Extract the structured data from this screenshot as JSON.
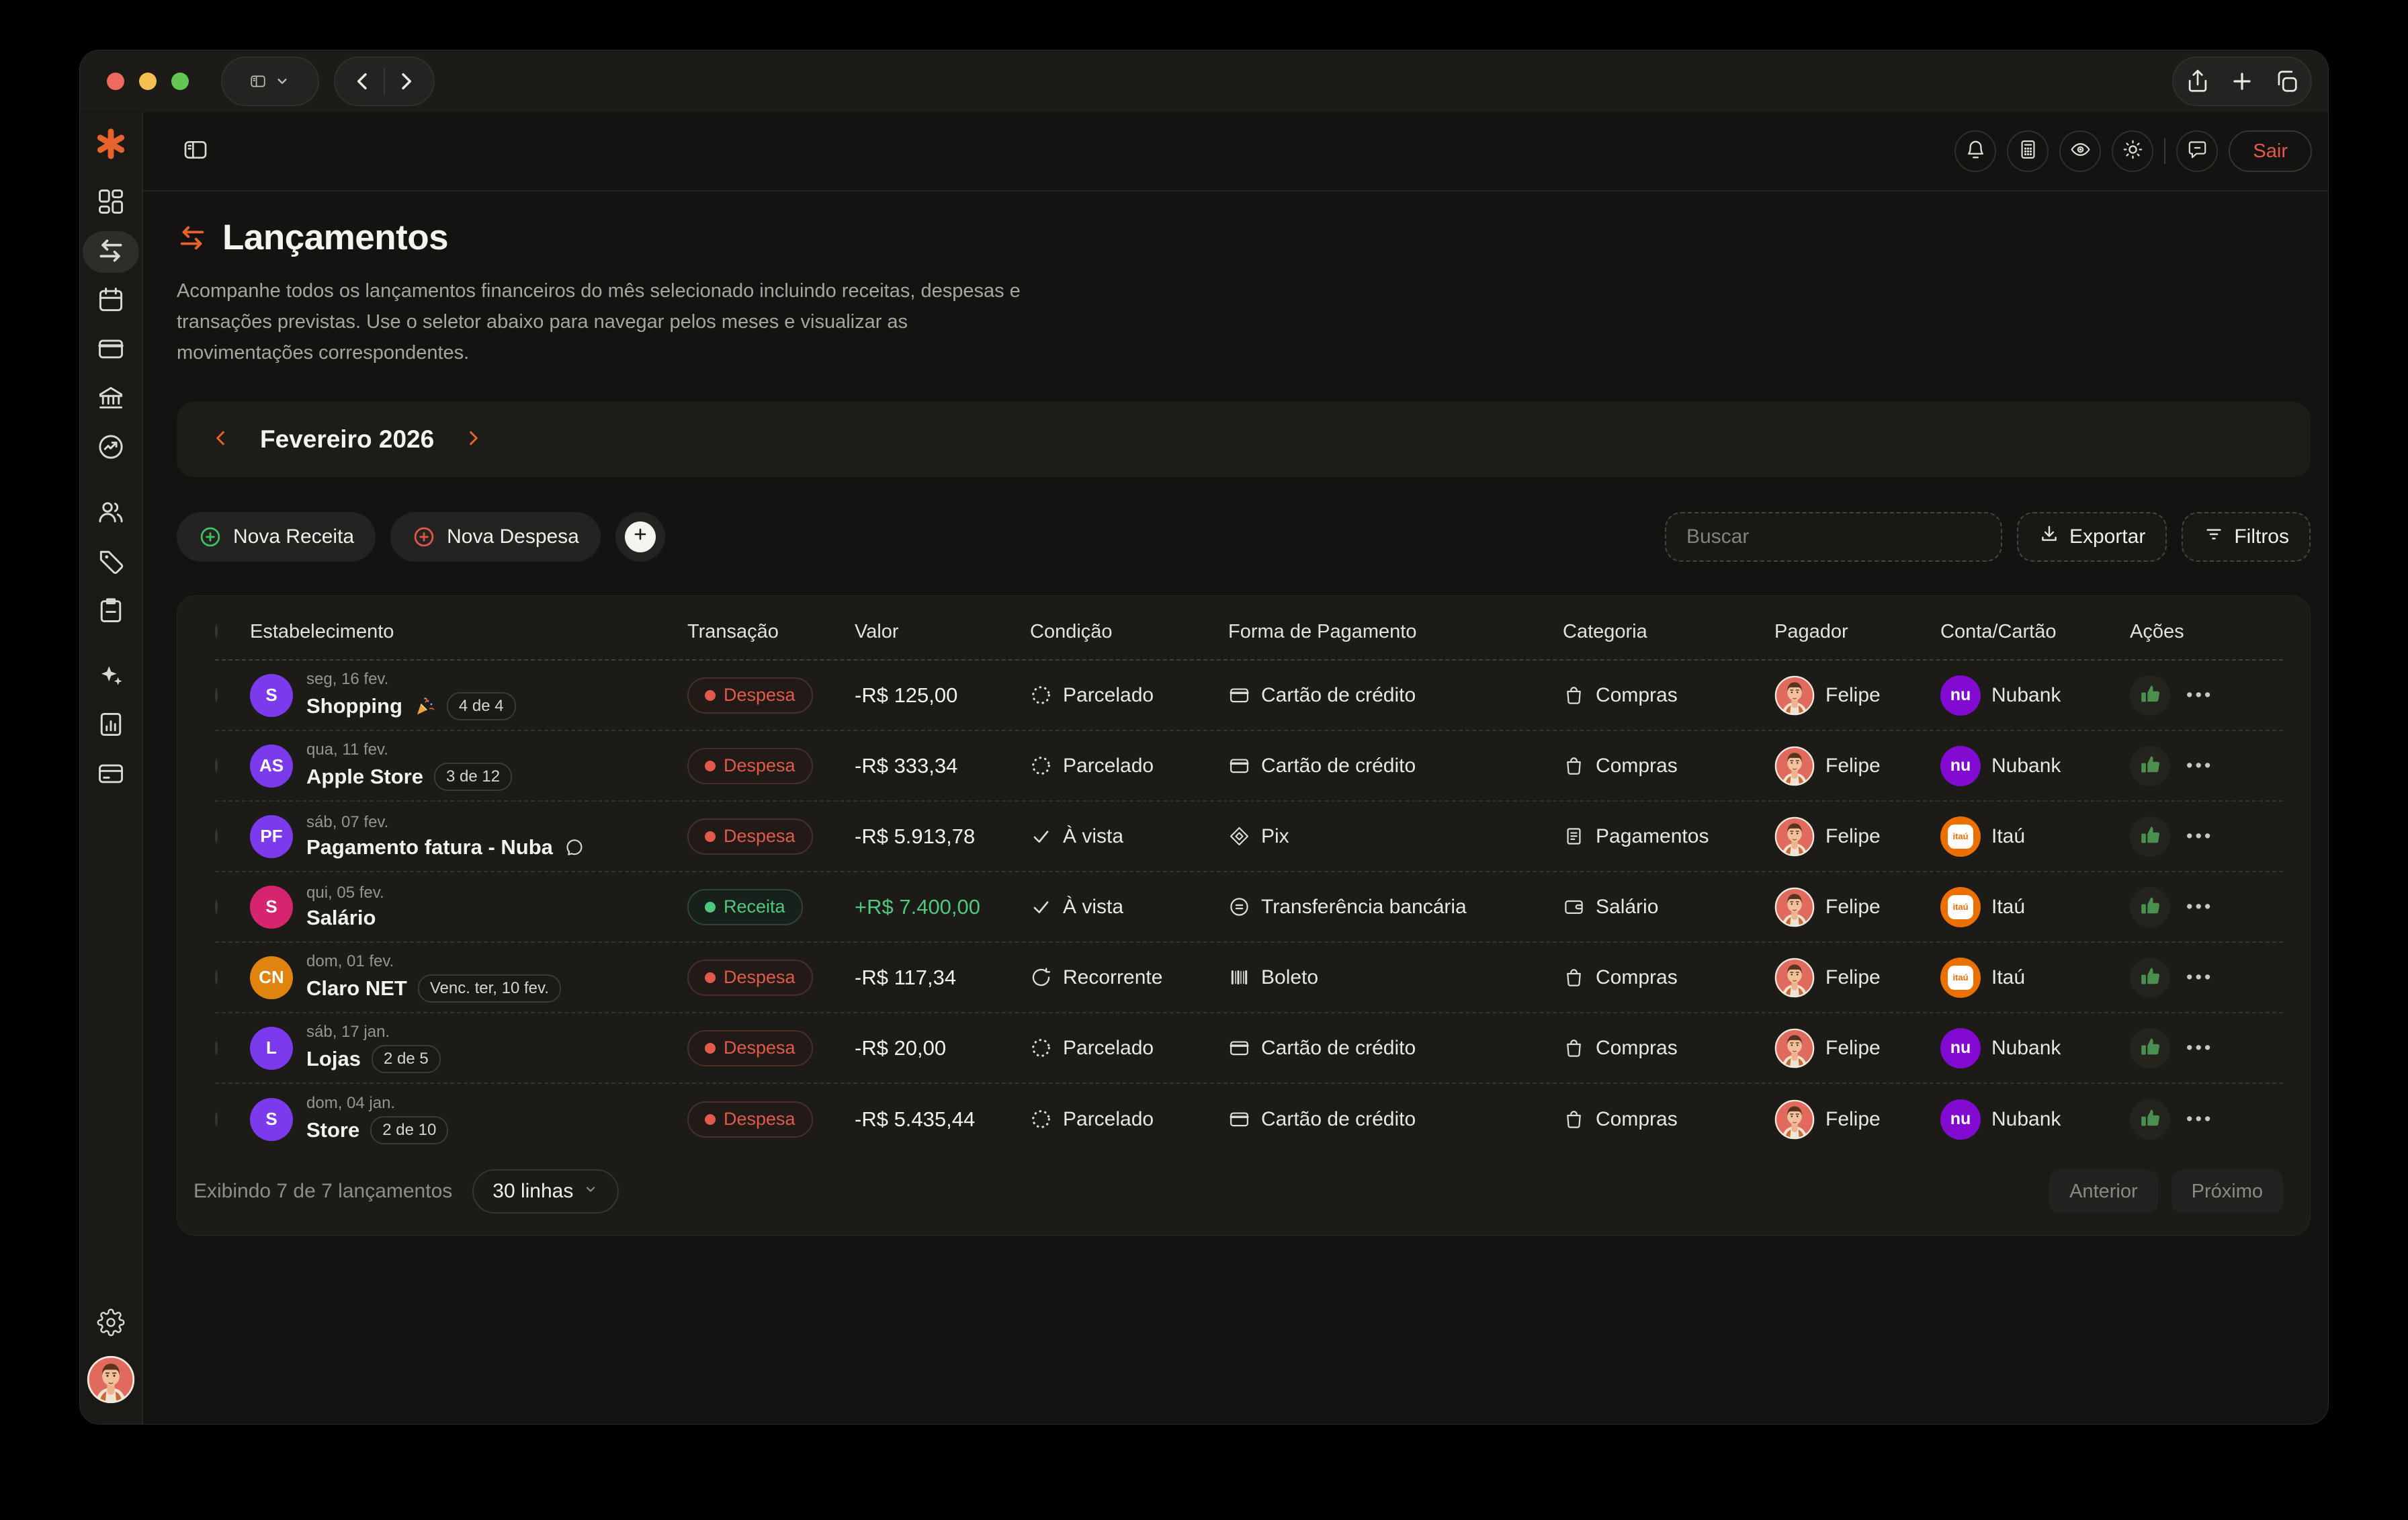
{
  "colors": {
    "accent": "#e8622c",
    "expense": "#e2574b",
    "income": "#4fc97d",
    "nubank": "#820ad1",
    "itau": "#ec7000"
  },
  "titlebar": {
    "left_icons": [
      "sidebar-toggle-icon",
      "chevron-down-icon"
    ],
    "nav_icons": [
      "chevron-left-icon",
      "chevron-right-icon"
    ],
    "right_icons": [
      "share-icon",
      "new-tab-icon",
      "tabs-icon"
    ]
  },
  "sidebar": {
    "logo_icon": "asterisk-logo",
    "items": [
      {
        "icon": "dashboard-icon"
      },
      {
        "icon": "transactions-icon",
        "active": true
      },
      {
        "icon": "calendar-icon"
      },
      {
        "icon": "credit-card-icon"
      },
      {
        "icon": "bank-icon"
      },
      {
        "icon": "goals-icon"
      },
      {
        "icon": "users-icon",
        "gap": true
      },
      {
        "icon": "tag-icon"
      },
      {
        "icon": "clipboard-icon"
      },
      {
        "icon": "sparkles-icon",
        "gap": true
      },
      {
        "icon": "report-icon"
      },
      {
        "icon": "accounts-icon"
      }
    ],
    "settings_icon": "gear-icon",
    "avatar_icon": "person-avatar"
  },
  "header": {
    "collapse_icon": "sidebar-toggle-icon",
    "icon_buttons": [
      "bell-icon",
      "calculator-icon",
      "eye-icon",
      "sun-icon"
    ],
    "chat_icon": "chat-icon",
    "logout_label": "Sair"
  },
  "page": {
    "title": "Lançamentos",
    "title_icon": "transactions-icon",
    "description": "Acompanhe todos os lançamentos financeiros do mês selecionado incluindo receitas, despesas e transações previstas. Use o seletor abaixo para navegar pelos meses e visualizar as movimentações correspondentes.",
    "month_selector": {
      "label": "Fevereiro 2026",
      "prev_icon": "chevron-left-icon",
      "next_icon": "chevron-right-icon"
    },
    "toolbar": {
      "new_income": "Nova Receita",
      "new_expense": "Nova Despesa",
      "search_placeholder": "Buscar",
      "export_label": "Exportar",
      "filters_label": "Filtros"
    },
    "table": {
      "columns": [
        "Estabelecimento",
        "Transação",
        "Valor",
        "Condição",
        "Forma de Pagamento",
        "Categoria",
        "Pagador",
        "Conta/Cartão",
        "Ações"
      ],
      "rows": [
        {
          "avatar": {
            "text": "S",
            "color": "#7c3aed"
          },
          "date": "seg, 16 fev.",
          "name": "Shopping",
          "party_icon": "party-icon",
          "badge": "4 de 4",
          "comment": false,
          "type": {
            "label": "Despesa",
            "kind": "expense"
          },
          "value": {
            "text": "-R$ 125,00",
            "kind": "expense"
          },
          "condition": {
            "icon": "installments-icon",
            "label": "Parcelado"
          },
          "payment": {
            "icon": "credit-card-icon",
            "label": "Cartão de crédito"
          },
          "category": {
            "icon": "shopping-bag-icon",
            "label": "Compras"
          },
          "payer": "Felipe",
          "account": {
            "label": "Nubank",
            "brand": "nubank"
          }
        },
        {
          "avatar": {
            "text": "AS",
            "color": "#7c3aed"
          },
          "date": "qua, 11 fev.",
          "name": "Apple Store",
          "badge": "3 de 12",
          "comment": false,
          "type": {
            "label": "Despesa",
            "kind": "expense"
          },
          "value": {
            "text": "-R$ 333,34",
            "kind": "expense"
          },
          "condition": {
            "icon": "installments-icon",
            "label": "Parcelado"
          },
          "payment": {
            "icon": "credit-card-icon",
            "label": "Cartão de crédito"
          },
          "category": {
            "icon": "shopping-bag-icon",
            "label": "Compras"
          },
          "payer": "Felipe",
          "account": {
            "label": "Nubank",
            "brand": "nubank"
          }
        },
        {
          "avatar": {
            "text": "PF",
            "color": "#7c3aed"
          },
          "date": "sáb, 07 fev.",
          "name": "Pagamento fatura - Nuba",
          "comment": true,
          "type": {
            "label": "Despesa",
            "kind": "expense"
          },
          "value": {
            "text": "-R$ 5.913,78",
            "kind": "expense"
          },
          "condition": {
            "icon": "check-icon",
            "label": "À vista"
          },
          "payment": {
            "icon": "pix-icon",
            "label": "Pix"
          },
          "category": {
            "icon": "payments-icon",
            "label": "Pagamentos"
          },
          "payer": "Felipe",
          "account": {
            "label": "Itaú",
            "brand": "itau"
          }
        },
        {
          "avatar": {
            "text": "S",
            "color": "#d6246e"
          },
          "date": "qui, 05 fev.",
          "name": "Salário",
          "comment": false,
          "type": {
            "label": "Receita",
            "kind": "income"
          },
          "value": {
            "text": "+R$ 7.400,00",
            "kind": "income"
          },
          "condition": {
            "icon": "check-icon",
            "label": "À vista"
          },
          "payment": {
            "icon": "bank-transfer-icon",
            "label": "Transferência bancária"
          },
          "category": {
            "icon": "salary-icon",
            "label": "Salário"
          },
          "payer": "Felipe",
          "account": {
            "label": "Itaú",
            "brand": "itau"
          }
        },
        {
          "avatar": {
            "text": "CN",
            "color": "#e0830f"
          },
          "date": "dom, 01 fev.",
          "name": "Claro NET",
          "badge": "Venc. ter, 10 fev.",
          "comment": false,
          "type": {
            "label": "Despesa",
            "kind": "expense"
          },
          "value": {
            "text": "-R$ 117,34",
            "kind": "expense"
          },
          "condition": {
            "icon": "recurring-icon",
            "label": "Recorrente"
          },
          "payment": {
            "icon": "boleto-icon",
            "label": "Boleto"
          },
          "category": {
            "icon": "shopping-bag-icon",
            "label": "Compras"
          },
          "payer": "Felipe",
          "account": {
            "label": "Itaú",
            "brand": "itau"
          }
        },
        {
          "avatar": {
            "text": "L",
            "color": "#7c3aed"
          },
          "date": "sáb, 17 jan.",
          "name": "Lojas",
          "badge": "2 de 5",
          "comment": false,
          "type": {
            "label": "Despesa",
            "kind": "expense"
          },
          "value": {
            "text": "-R$ 20,00",
            "kind": "expense"
          },
          "condition": {
            "icon": "installments-icon",
            "label": "Parcelado"
          },
          "payment": {
            "icon": "credit-card-icon",
            "label": "Cartão de crédito"
          },
          "category": {
            "icon": "shopping-bag-icon",
            "label": "Compras"
          },
          "payer": "Felipe",
          "account": {
            "label": "Nubank",
            "brand": "nubank"
          }
        },
        {
          "avatar": {
            "text": "S",
            "color": "#7c3aed"
          },
          "date": "dom, 04 jan.",
          "name": "Store",
          "badge": "2 de 10",
          "comment": false,
          "type": {
            "label": "Despesa",
            "kind": "expense"
          },
          "value": {
            "text": "-R$ 5.435,44",
            "kind": "expense"
          },
          "condition": {
            "icon": "installments-icon",
            "label": "Parcelado"
          },
          "payment": {
            "icon": "credit-card-icon",
            "label": "Cartão de crédito"
          },
          "category": {
            "icon": "shopping-bag-icon",
            "label": "Compras"
          },
          "payer": "Felipe",
          "account": {
            "label": "Nubank",
            "brand": "nubank"
          }
        }
      ],
      "footer": {
        "summary": "Exibindo 7 de 7 lançamentos",
        "page_size": "30 linhas",
        "prev_label": "Anterior",
        "next_label": "Próximo"
      }
    }
  }
}
